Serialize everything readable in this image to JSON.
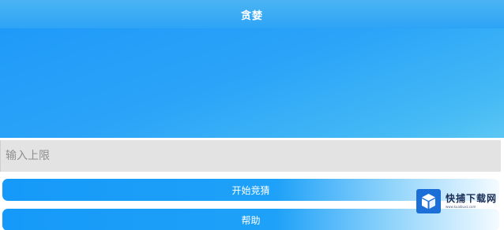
{
  "header": {
    "title": "贪婪"
  },
  "input": {
    "placeholder": "输入上限",
    "value": ""
  },
  "buttons": {
    "start_label": "开始竞猜",
    "help_label": "帮助"
  },
  "watermark": {
    "name": "快捕下载网",
    "url": "www.kuaibuxz.com"
  },
  "colors": {
    "accent": "#1f9af8",
    "banner_light": "#5cc7f3",
    "input_bg": "#e3e3e3"
  }
}
